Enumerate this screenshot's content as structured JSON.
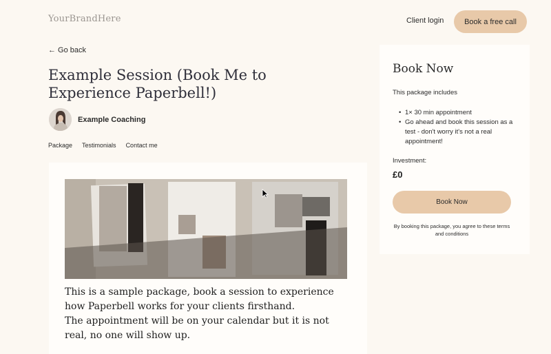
{
  "header": {
    "logo": "YourBrandHere",
    "client_login": "Client login",
    "cta": "Book a free call"
  },
  "back": "← Go back",
  "title": "Example Session (Book Me to Experience Paperbell!)",
  "coach": {
    "name": "Example Coaching"
  },
  "subnav": [
    "Package",
    "Testimonials",
    "Contact me"
  ],
  "description": [
    "This is a sample package, book a session to experience how Paperbell works for your clients firsthand.",
    "The appointment will be on your calendar but it is not real, no one will show up."
  ],
  "booking": {
    "title": "Book Now",
    "includes_label": "This package includes",
    "includes": [
      "1× 30 min appointment",
      "Go ahead and book this session as a test - don't worry it's not a real appointment!"
    ],
    "investment_label": "Investment:",
    "price": "£0",
    "button": "Book Now",
    "terms": "By booking this package, you agree to these terms and conditions"
  },
  "colors": {
    "background": "#fcf8f2",
    "accent": "#e8c9a9",
    "card": "#fffdfa"
  }
}
